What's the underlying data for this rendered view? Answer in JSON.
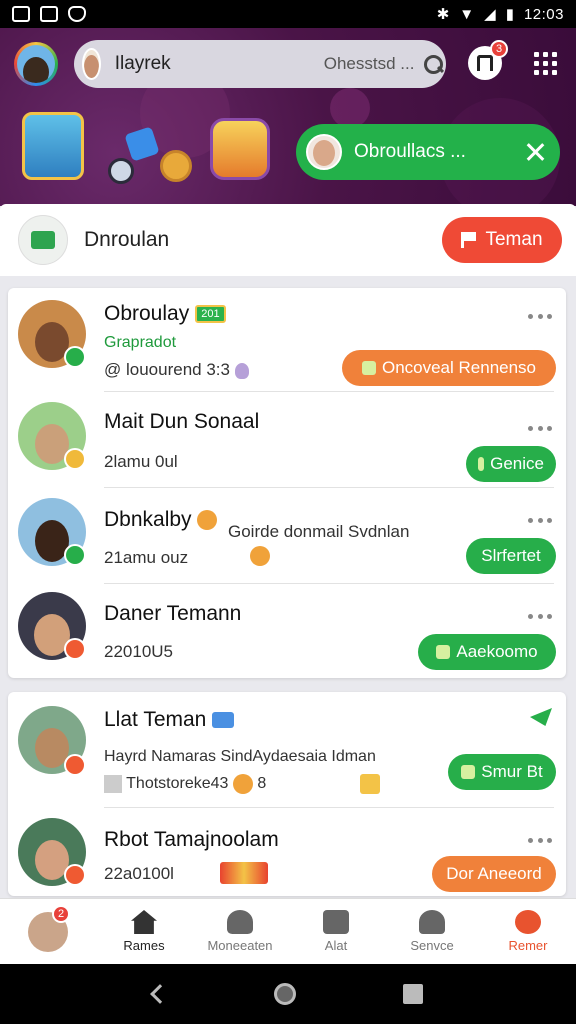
{
  "status_bar": {
    "time": "12:03"
  },
  "header": {
    "search": {
      "name": "Ilayrek",
      "value": "Ohesstsd ..."
    },
    "notification_count": "3",
    "toast": {
      "text": "Obroullacs ..."
    }
  },
  "section": {
    "title": "Dnroulan",
    "action_label": "Teman"
  },
  "friends": [
    {
      "name": "Obroulay",
      "tag": "201",
      "status": "Grapradot",
      "subtext": "@ louourend 3:3",
      "button": "Oncoveal Rennenso",
      "button_color": "#f0813a"
    },
    {
      "name": "Mait Dun Sonaal",
      "subtext": "2lamu 0ul",
      "button": "Genice",
      "button_color": "#27ae4a"
    },
    {
      "name": "Dbnkalby",
      "aside": "Goirde donmail Svdnlan",
      "subtext": "21amu ouz",
      "button": "Slrfertet",
      "button_color": "#27ae4a"
    },
    {
      "name": "Daner Temann",
      "subtext": "22010U5",
      "button": "Aaekoomo",
      "button_color": "#27ae4a"
    }
  ],
  "friends_2": [
    {
      "name": "Llat Teman",
      "subtext": "Hayrd Namaras SindAydaesaia Idman",
      "subtext2": "Thotstoreke43",
      "subtext2_count": "8",
      "button": "Smur Bt",
      "button_color": "#27ae4a"
    },
    {
      "name": "Rbot Tamajnoolam",
      "subtext": "22a0100l",
      "button": "Dor Aneeord",
      "button_color": "#f0813a"
    }
  ],
  "bottom_nav": [
    {
      "label": "",
      "icon": "avatar",
      "badge": "2"
    },
    {
      "label": "Rames",
      "icon": "home-icon"
    },
    {
      "label": "Moneeaten",
      "icon": "gamepad-icon"
    },
    {
      "label": "Alat",
      "icon": "chart-icon"
    },
    {
      "label": "Senvce",
      "icon": "people-icon"
    },
    {
      "label": "Remer",
      "icon": "chat-icon"
    }
  ],
  "colors": {
    "accent_green": "#27ae4a",
    "accent_orange": "#f0813a",
    "accent_red": "#ef4a36",
    "header_purple": "#4a1447"
  }
}
